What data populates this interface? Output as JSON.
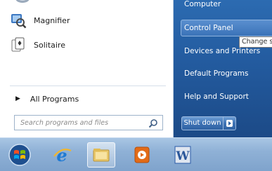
{
  "left_pane": {
    "programs": [
      {
        "label": "Magnifier",
        "icon": "magnifier-icon"
      },
      {
        "label": "Solitaire",
        "icon": "solitaire-icon"
      }
    ],
    "all_programs": "All Programs",
    "search": {
      "placeholder": "Search programs and files",
      "value": ""
    }
  },
  "right_pane": {
    "items": [
      "Computer",
      "Control Panel",
      "Devices and Printers",
      "Default Programs",
      "Help and Support"
    ],
    "highlighted_item": "Control Panel",
    "tooltip": "Change s",
    "shutdown_label": "Shut down"
  },
  "taskbar": {
    "items": [
      "start-orb-icon",
      "internet-explorer-icon",
      "file-explorer-icon",
      "media-player-icon",
      "word-icon"
    ]
  },
  "colors": {
    "right_pane": "#235b9f",
    "taskbar": "#8fb1d6",
    "highlight": "#3b73b8"
  }
}
